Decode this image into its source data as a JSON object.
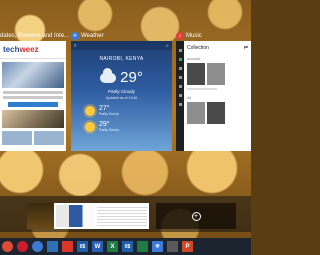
{
  "apps": [
    {
      "title": "dates, Reviews and Inte...",
      "icon": "edge-icon",
      "site_logo": {
        "main": "tech",
        "accent": "weez"
      }
    },
    {
      "title": "Weather",
      "icon": "weather-icon",
      "location": "NAIROBI, KENYA",
      "temperature": "29°",
      "condition": "Partly Cloudy",
      "details": "Updated as of 13:46",
      "forecast": [
        {
          "temp": "27°",
          "note": "Partly Sunny"
        },
        {
          "temp": "29°",
          "note": "Partly Sunny"
        }
      ]
    },
    {
      "title": "Music",
      "icon": "music-icon",
      "heading": "Collection",
      "section1": "Acoustic",
      "section2": "Alt"
    }
  ],
  "desktops": {
    "new_desktop_symbol": "+"
  },
  "taskbar": {
    "items": [
      "chrome-icon",
      "opera-icon",
      "chrome-icon",
      "photos-icon",
      "acrobat-icon",
      "onedrive-icon",
      "word-icon",
      "excel-icon",
      "onenote-icon",
      "excel-icon",
      "weather-icon",
      "music-icon",
      "powerpoint-icon"
    ],
    "labels": {
      "onedrive": "0$",
      "word": "W",
      "excel": "X",
      "onenote": "0$",
      "powerpoint": "P"
    }
  },
  "colors": {
    "edge": "#2e7dd1",
    "weather": "#3b7ad9",
    "music": "#e1403a",
    "taskbar": "#1c2430"
  }
}
